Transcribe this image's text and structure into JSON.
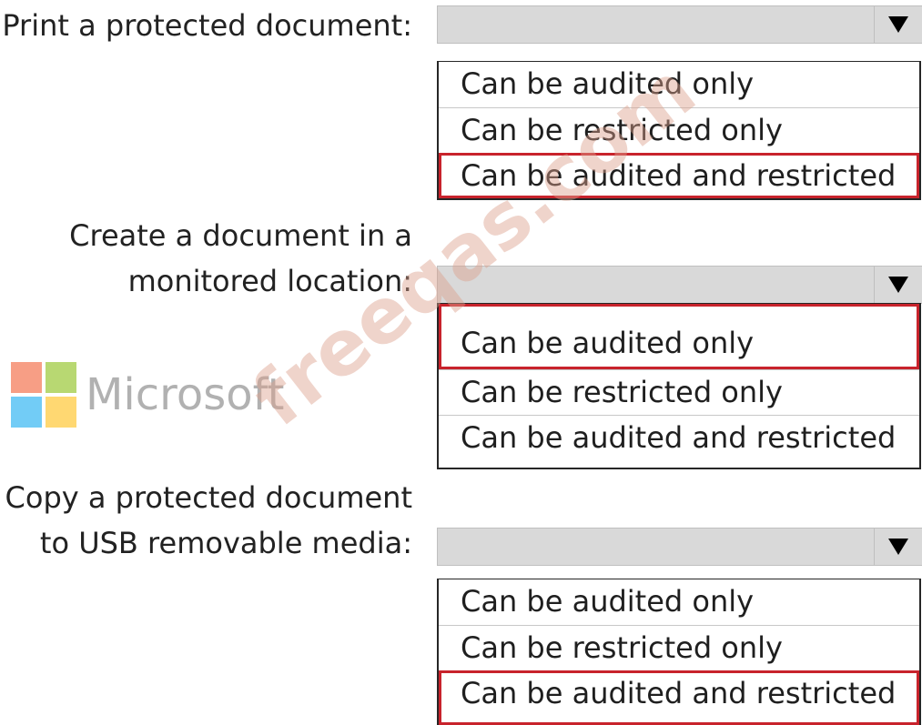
{
  "questions": [
    {
      "label_lines": [
        "Print a protected document:"
      ],
      "options": [
        "Can be audited only",
        "Can be restricted only",
        "Can be audited and restricted"
      ],
      "selected_index": 2
    },
    {
      "label_lines": [
        "Create a document in a",
        "monitored location:"
      ],
      "options": [
        "Can be audited only",
        "Can be restricted only",
        "Can be audited and restricted"
      ],
      "selected_index": 0
    },
    {
      "label_lines": [
        "Copy a protected document",
        "to USB removable media:"
      ],
      "options": [
        "Can be audited only",
        "Can be restricted only",
        "Can be audited and restricted"
      ],
      "selected_index": 2
    }
  ],
  "logo": {
    "text": "Microsoft",
    "colors": [
      "#f25022",
      "#7fba00",
      "#00a4ef",
      "#ffb900"
    ]
  },
  "watermark": "freeqas.com",
  "icons": {
    "dropdown": "triangle-down-icon"
  },
  "colors": {
    "selection_outline": "#c8232c",
    "dropdown_header": "#d9d9d9"
  }
}
